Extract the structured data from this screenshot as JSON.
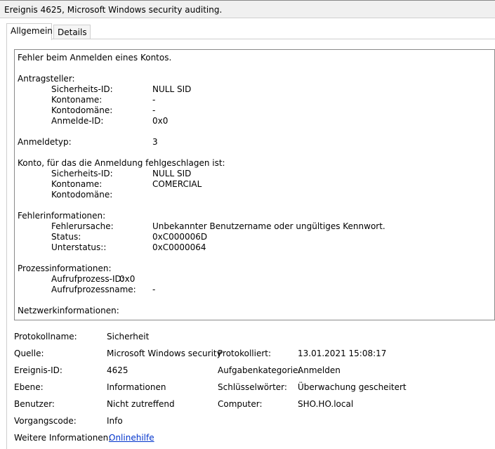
{
  "window": {
    "title": "Ereignis 4625, Microsoft Windows security auditing."
  },
  "tabs": [
    {
      "label": "Allgemein"
    },
    {
      "label": "Details"
    }
  ],
  "message": {
    "headline": "Fehler beim Anmelden eines Kontos.",
    "subject": {
      "header": "Antragsteller:",
      "rows": [
        {
          "label": "Sicherheits-ID:",
          "value": "NULL SID"
        },
        {
          "label": "Kontoname:",
          "value": "-"
        },
        {
          "label": "Kontodomäne:",
          "value": "-"
        },
        {
          "label": "Anmelde-ID:",
          "value": "0x0"
        }
      ]
    },
    "logon_type": {
      "label": "Anmeldetyp:",
      "value": "3"
    },
    "account": {
      "header": "Konto, für das die Anmeldung fehlgeschlagen ist:",
      "rows": [
        {
          "label": "Sicherheits-ID:",
          "value": "NULL SID"
        },
        {
          "label": "Kontoname:",
          "value": "COMERCIAL"
        },
        {
          "label": "Kontodomäne:",
          "value": ""
        }
      ]
    },
    "failure": {
      "header": "Fehlerinformationen:",
      "rows": [
        {
          "label": "Fehlerursache:",
          "value": "Unbekannter Benutzername oder ungültiges Kennwort."
        },
        {
          "label": "Status:",
          "value": "0xC000006D"
        },
        {
          "label": "Unterstatus::",
          "value": "0xC0000064"
        }
      ]
    },
    "process": {
      "header": "Prozessinformationen:",
      "rows": [
        {
          "label": "Aufrufprozess-ID:",
          "value": "0x0"
        },
        {
          "label": "Aufrufprozessname:",
          "value": "-"
        }
      ]
    },
    "network": {
      "header": "Netzwerkinformationen:"
    }
  },
  "meta": {
    "protokollname": {
      "label": "Protokollname:",
      "value": "Sicherheit"
    },
    "quelle": {
      "label": "Quelle:",
      "value": "Microsoft Windows security"
    },
    "protokolliert": {
      "label": "Protokolliert:",
      "value": "13.01.2021 15:08:17"
    },
    "ereignis_id": {
      "label": "Ereignis-ID:",
      "value": "4625"
    },
    "aufgabenkategorie": {
      "label": "Aufgabenkategorie:",
      "value": "Anmelden"
    },
    "ebene": {
      "label": "Ebene:",
      "value": "Informationen"
    },
    "schluesselwoerter": {
      "label": "Schlüsselwörter:",
      "value": "Überwachung gescheitert"
    },
    "benutzer": {
      "label": "Benutzer:",
      "value": "Nicht zutreffend"
    },
    "computer": {
      "label": "Computer:",
      "value": "SHO.HO.local"
    },
    "vorgangscode": {
      "label": "Vorgangscode:",
      "value": "Info"
    },
    "weitere": {
      "label": "Weitere Informationen:",
      "value": "Onlinehilfe"
    }
  }
}
